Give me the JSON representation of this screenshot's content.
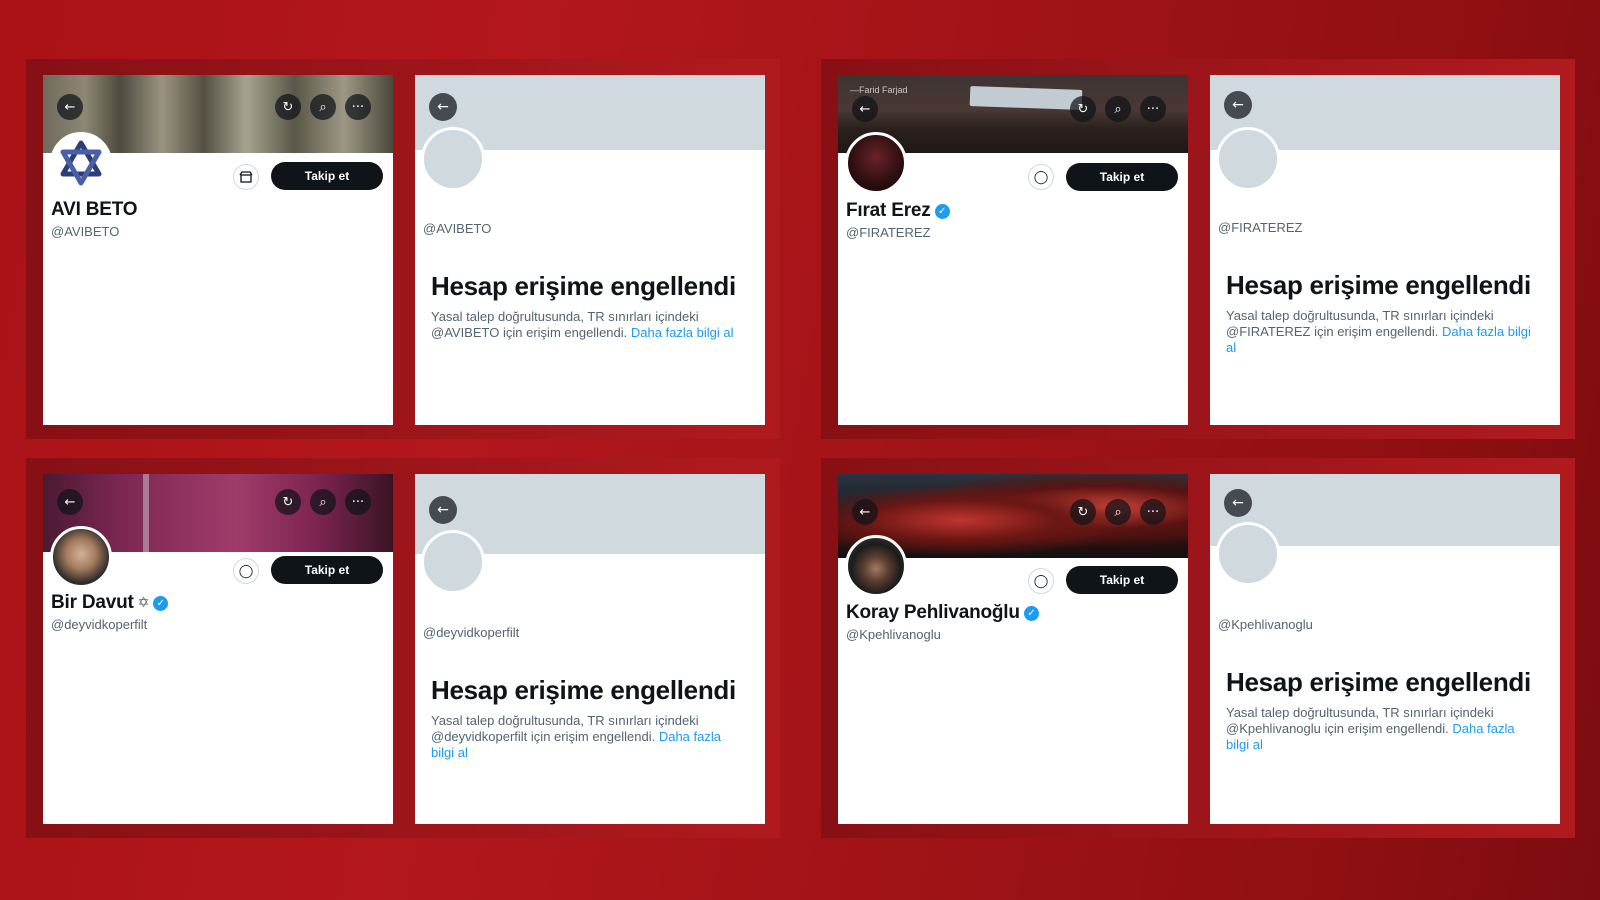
{
  "common": {
    "follow_label": "Takip et",
    "back_glyph": "←",
    "repost_glyph": "↻",
    "search_glyph": "⌕",
    "more_glyph": "···",
    "message_glyph": "◯",
    "verified_glyph": "✓",
    "withheld_title": "Hesap erişime engellendi",
    "withheld_text_before": "Yasal talep doğrultusunda, TR sınırları içindeki",
    "withheld_text_after": "için erişim engellendi.",
    "learn_more": "Daha fazla bilgi al"
  },
  "profiles": [
    {
      "name": "AVI BETO",
      "handle": "@AVIBETO",
      "handle_plain": "@AVIBETO",
      "verified": false,
      "banner_text": "",
      "action_icon": "store-icon"
    },
    {
      "name": "Fırat Erez",
      "handle": "@FIRATEREZ",
      "handle_plain": "@FIRATEREZ",
      "verified": true,
      "banner_text": "—Farid Farjad",
      "action_icon": "message-icon"
    },
    {
      "name": "Bir Davut",
      "handle": "@deyvidkoperfilt",
      "handle_plain": "@deyvidkoperfilt",
      "verified": true,
      "star": "✡",
      "banner_text": "",
      "action_icon": "message-icon"
    },
    {
      "name": "Koray Pehlivanoğlu",
      "handle": "@Kpehlivanoglu",
      "handle_plain": "@Kpehlivanoglu",
      "verified": true,
      "banner_text": "",
      "action_icon": "message-icon"
    }
  ],
  "colors": {
    "background": "#a91216",
    "follow_button": "#0f1419",
    "verified": "#1d9bf0",
    "link": "#1d9bf0",
    "placeholder": "#cfd9de"
  }
}
